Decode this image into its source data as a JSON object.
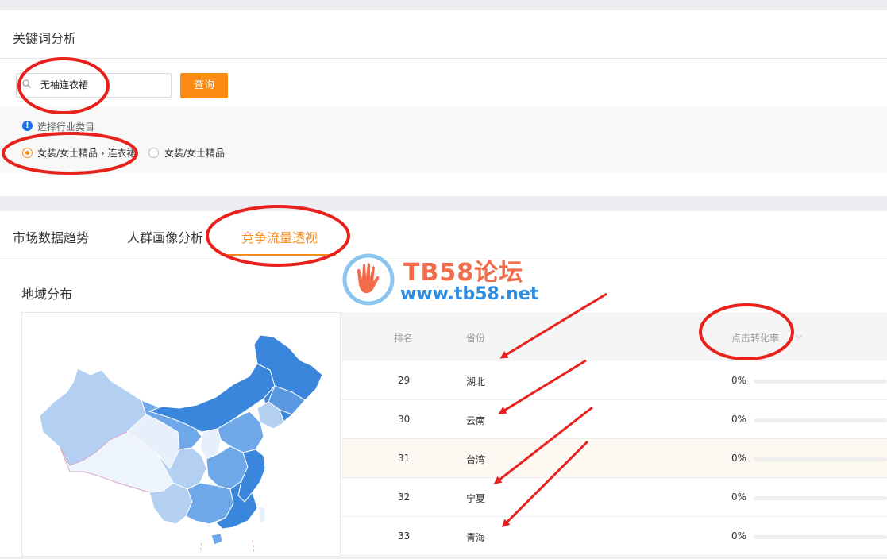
{
  "page_title": "关键词分析",
  "search": {
    "value": "无袖连衣裙",
    "button_label": "查询"
  },
  "industry": {
    "label": "选择行业类目",
    "options": [
      {
        "label": "女装/女士精品 › 连衣裙",
        "selected": true
      },
      {
        "label": "女装/女士精品",
        "selected": false
      }
    ]
  },
  "tabs": [
    {
      "label": "市场数据趋势",
      "active": false
    },
    {
      "label": "人群画像分析",
      "active": false
    },
    {
      "label": "竞争流量透视",
      "active": true
    }
  ],
  "region_section": {
    "title": "地域分布",
    "table": {
      "headers": [
        "排名",
        "省份",
        "点击转化率"
      ],
      "rows": [
        {
          "rank": "29",
          "province": "湖北",
          "rate": "0%",
          "fill": 0
        },
        {
          "rank": "30",
          "province": "云南",
          "rate": "0%",
          "fill": 0
        },
        {
          "rank": "31",
          "province": "台湾",
          "rate": "0%",
          "fill": 0
        },
        {
          "rank": "32",
          "province": "宁夏",
          "rate": "0%",
          "fill": 0
        },
        {
          "rank": "33",
          "province": "青海",
          "rate": "0%",
          "fill": 0
        }
      ]
    }
  },
  "watermark": {
    "title": "TB58论坛",
    "url": "www.tb58.net"
  },
  "colors": {
    "accent": "#fa8c16",
    "annotation": "#e8211d",
    "map_dark": "#3a86dc",
    "map_mid": "#6ea8e8",
    "map_light": "#b3cff2",
    "map_pale": "#e7effa"
  }
}
